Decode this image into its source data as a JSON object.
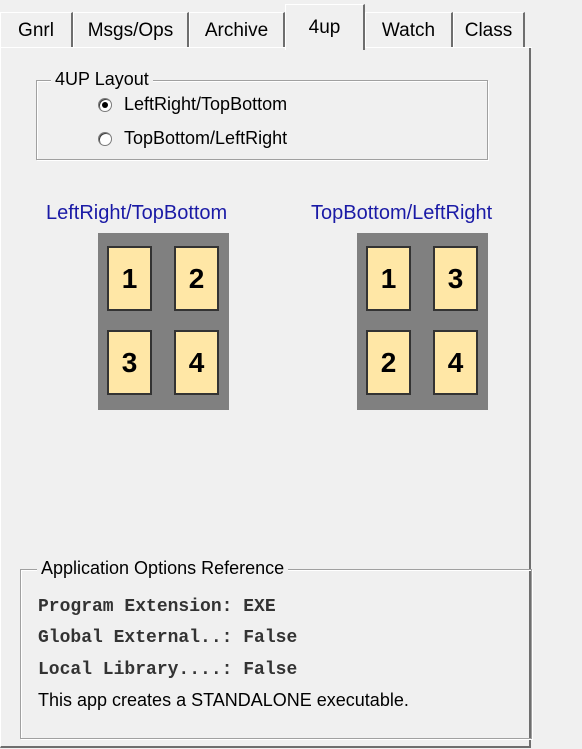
{
  "tabs": [
    {
      "label": "Gnrl"
    },
    {
      "label": "Msgs/Ops"
    },
    {
      "label": "Archive"
    },
    {
      "label": "4up"
    },
    {
      "label": "Watch"
    },
    {
      "label": "Class"
    }
  ],
  "active_tab": "4up",
  "layout_group": {
    "legend": "4UP Layout",
    "options": [
      {
        "label": "LeftRight/TopBottom",
        "checked": true
      },
      {
        "label": "TopBottom/LeftRight",
        "checked": false
      }
    ]
  },
  "previews": [
    {
      "title": "LeftRight/TopBottom",
      "cells": [
        "1",
        "2",
        "3",
        "4"
      ]
    },
    {
      "title": "TopBottom/LeftRight",
      "cells": [
        "1",
        "3",
        "2",
        "4"
      ]
    }
  ],
  "reference": {
    "legend": "Application Options Reference",
    "lines": [
      "Program Extension: EXE",
      "Global External..: False",
      "Local Library....: False"
    ],
    "note": "This app creates a STANDALONE executable."
  },
  "colors": {
    "preview_title": "#1a1aa6",
    "cell_fill": "#ffe7a6",
    "grid_bg": "#808080",
    "window_bg": "#f0f0f0"
  }
}
